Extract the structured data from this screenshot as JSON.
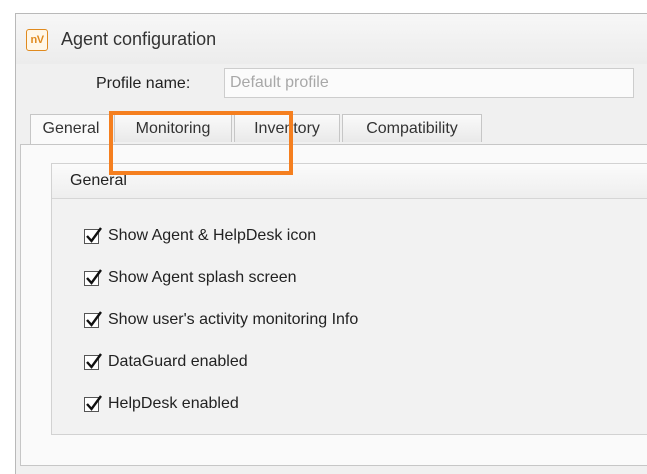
{
  "window": {
    "title": "Agent configuration",
    "app_logo_text": "nV"
  },
  "profile": {
    "label": "Profile name:",
    "placeholder": "Default profile",
    "value": ""
  },
  "tabs": [
    {
      "label": "General",
      "active": true
    },
    {
      "label": "Monitoring",
      "active": false
    },
    {
      "label": "Inventory",
      "active": false
    },
    {
      "label": "Compatibility",
      "active": false
    }
  ],
  "group": {
    "title": "General",
    "options": [
      {
        "label": "Show Agent & HelpDesk icon",
        "checked": true
      },
      {
        "label": "Show Agent splash screen",
        "checked": true
      },
      {
        "label": "Show user's activity monitoring Info",
        "checked": true
      },
      {
        "label": "DataGuard enabled",
        "checked": true
      },
      {
        "label": "HelpDesk enabled",
        "checked": true
      }
    ]
  },
  "colors": {
    "highlight": "#f57f1f",
    "logo": "#e08a1e"
  }
}
